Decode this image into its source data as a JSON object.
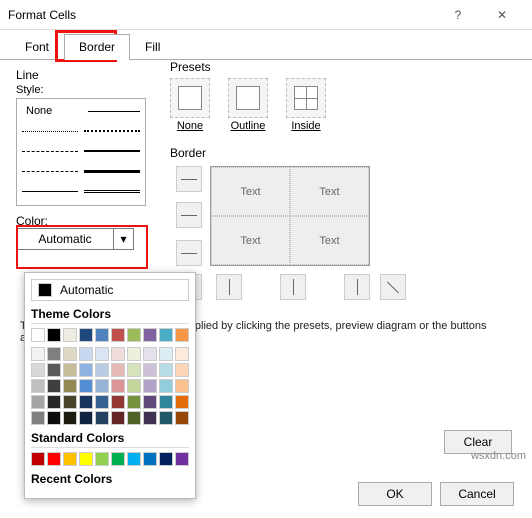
{
  "window": {
    "title": "Format Cells"
  },
  "tabs": {
    "font": "Font",
    "border": "Border",
    "fill": "Fill"
  },
  "line": {
    "label": "Line",
    "style_label": "Style:",
    "none": "None"
  },
  "color": {
    "label": "Color:",
    "selected": "Automatic",
    "automatic_item": "Automatic"
  },
  "presets": {
    "label": "Presets",
    "none": "None",
    "outline": "Outline",
    "inside": "Inside"
  },
  "border": {
    "label": "Border",
    "sample": "Text"
  },
  "explain": "The selected border style can be applied by clicking the presets, preview diagram or the buttons above.",
  "buttons": {
    "clear": "Clear",
    "ok": "OK",
    "cancel": "Cancel"
  },
  "popup": {
    "theme_title": "Theme Colors",
    "standard_title": "Standard Colors",
    "recent_title": "Recent Colors",
    "theme_head": [
      "#ffffff",
      "#000000",
      "#eeece1",
      "#1f497d",
      "#4f81bd",
      "#c0504d",
      "#9bbb59",
      "#8064a2",
      "#4bacc6",
      "#f79646"
    ],
    "theme_shades": [
      [
        "#f2f2f2",
        "#7f7f7f",
        "#ddd9c3",
        "#c6d9f0",
        "#dbe5f1",
        "#f2dcdb",
        "#ebf1dd",
        "#e5e0ec",
        "#dbeef3",
        "#fdeada"
      ],
      [
        "#d8d8d8",
        "#595959",
        "#c4bd97",
        "#8db3e2",
        "#b8cce4",
        "#e5b9b7",
        "#d7e3bc",
        "#ccc1d9",
        "#b7dde8",
        "#fbd5b5"
      ],
      [
        "#bfbfbf",
        "#3f3f3f",
        "#938953",
        "#548dd4",
        "#95b3d7",
        "#d99694",
        "#c3d69b",
        "#b2a2c7",
        "#92cddc",
        "#fac08f"
      ],
      [
        "#a5a5a5",
        "#262626",
        "#494429",
        "#17365d",
        "#366092",
        "#953734",
        "#76923c",
        "#5f497a",
        "#31859b",
        "#e36c09"
      ],
      [
        "#7f7f7f",
        "#0c0c0c",
        "#1d1b10",
        "#0f243e",
        "#244061",
        "#632423",
        "#4f6228",
        "#3f3151",
        "#205867",
        "#974806"
      ]
    ],
    "standard": [
      "#c00000",
      "#ff0000",
      "#ffc000",
      "#ffff00",
      "#92d050",
      "#00b050",
      "#00b0f0",
      "#0070c0",
      "#002060",
      "#7030a0"
    ]
  },
  "watermark": "wsxdn.com"
}
